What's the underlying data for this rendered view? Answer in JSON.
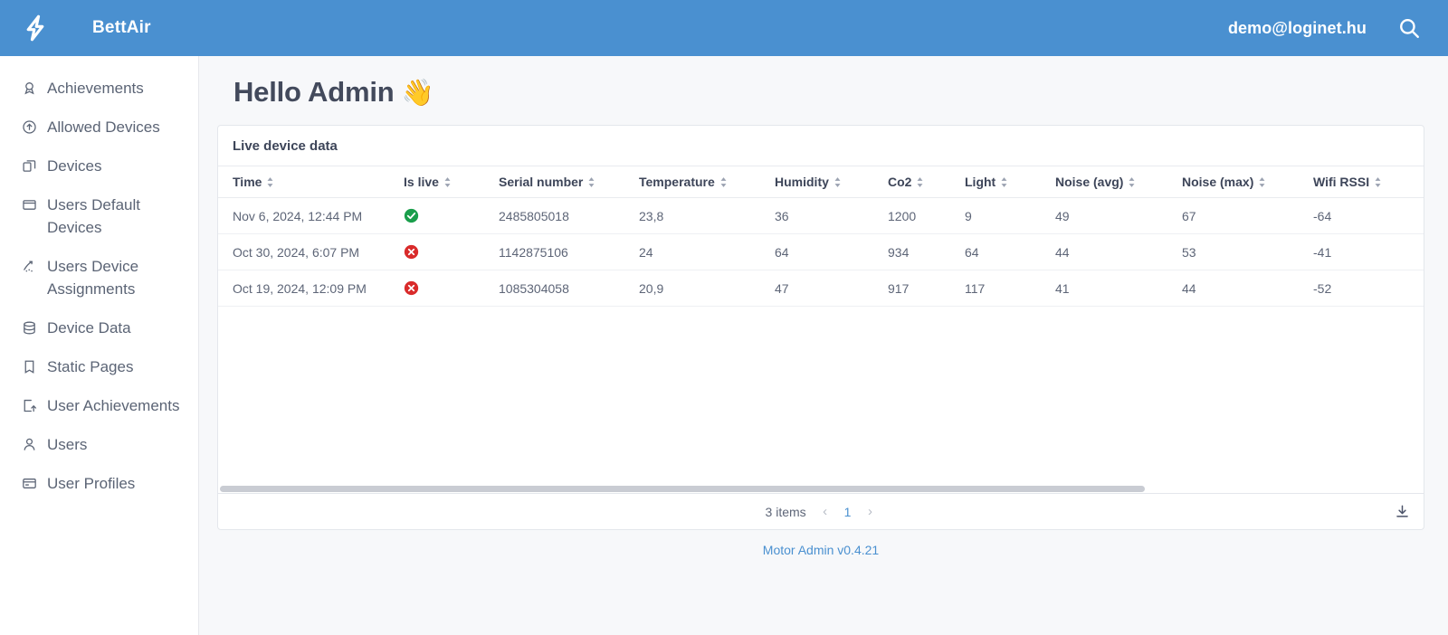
{
  "theme": {
    "header_bg": "#4a90d0",
    "accent": "#4a90d0",
    "content_bg": "#f7f8fa",
    "text": "#5d6577",
    "heading": "#434a5c",
    "success": "#1a9e4b",
    "danger": "#d92b2b"
  },
  "header": {
    "logo_icon": "lightning-bolt-icon",
    "brand": "BettAir",
    "user_email": "demo@loginet.hu",
    "search_icon": "search-icon"
  },
  "sidebar": {
    "items": [
      {
        "label": "Achievements",
        "icon": "award-icon"
      },
      {
        "label": "Allowed Devices",
        "icon": "arrow-up-circle-icon"
      },
      {
        "label": "Devices",
        "icon": "copy-icon"
      },
      {
        "label": "Users Default Devices",
        "icon": "window-icon"
      },
      {
        "label": "Users Device Assignments",
        "icon": "assignment-icon"
      },
      {
        "label": "Device Data",
        "icon": "database-icon"
      },
      {
        "label": "Static Pages",
        "icon": "page-icon"
      },
      {
        "label": "User Achievements",
        "icon": "export-icon"
      },
      {
        "label": "Users",
        "icon": "user-icon"
      },
      {
        "label": "User Profiles",
        "icon": "card-icon"
      }
    ]
  },
  "main": {
    "title": "Hello Admin",
    "title_emoji": "👋",
    "card_title": "Live device data",
    "columns": [
      "Time",
      "Is live",
      "Serial number",
      "Temperature",
      "Humidity",
      "Co2",
      "Light",
      "Noise (avg)",
      "Noise (max)",
      "Wifi RSSI"
    ],
    "rows": [
      {
        "time": "Nov 6, 2024, 12:44 PM",
        "is_live": true,
        "serial_number": "2485805018",
        "temperature": "23,8",
        "humidity": "36",
        "co2": "1200",
        "light": "9",
        "noise_avg": "49",
        "noise_max": "67",
        "wifi_rssi": "-64"
      },
      {
        "time": "Oct 30, 2024, 6:07 PM",
        "is_live": false,
        "serial_number": "1142875106",
        "temperature": "24",
        "humidity": "64",
        "co2": "934",
        "light": "64",
        "noise_avg": "44",
        "noise_max": "53",
        "wifi_rssi": "-41"
      },
      {
        "time": "Oct 19, 2024, 12:09 PM",
        "is_live": false,
        "serial_number": "1085304058",
        "temperature": "20,9",
        "humidity": "47",
        "co2": "917",
        "light": "117",
        "noise_avg": "41",
        "noise_max": "44",
        "wifi_rssi": "-52"
      }
    ],
    "footer": {
      "items_count": "3 items",
      "prev_arrow": "‹",
      "page_number": "1",
      "next_arrow": "›",
      "download_icon": "download-icon"
    }
  },
  "version": {
    "label": "Motor Admin v0.4.21"
  }
}
